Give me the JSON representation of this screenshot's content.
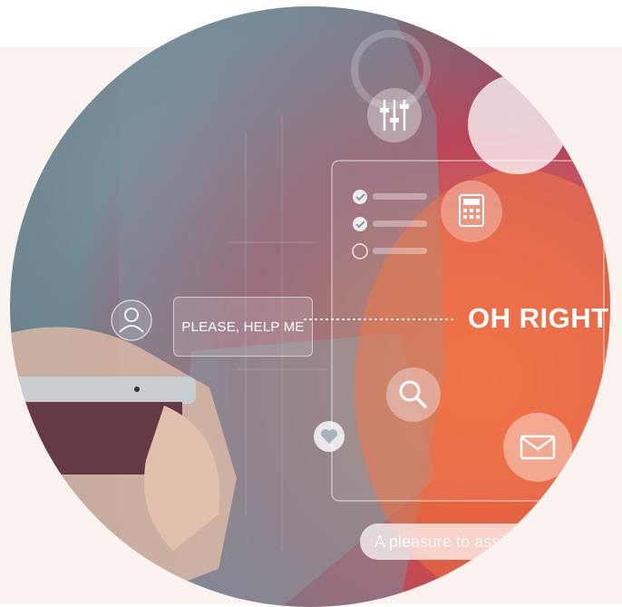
{
  "scene": {
    "description_free": true,
    "accent_colors": {
      "orange": "#f06a3c",
      "muted_blue": "#6d8590",
      "band": "#fbf3ef"
    }
  },
  "chips": {
    "help_text": "PLEASE, HELP ME",
    "reply_text": "OH RIGHT",
    "pleasure_text": "A pleasure to assis"
  },
  "icons": [
    "user-icon",
    "sliders-icon",
    "calculator-icon",
    "search-icon",
    "mail-icon",
    "heart-icon",
    "gear-icon",
    "checklist-icon",
    "phone-icon"
  ]
}
